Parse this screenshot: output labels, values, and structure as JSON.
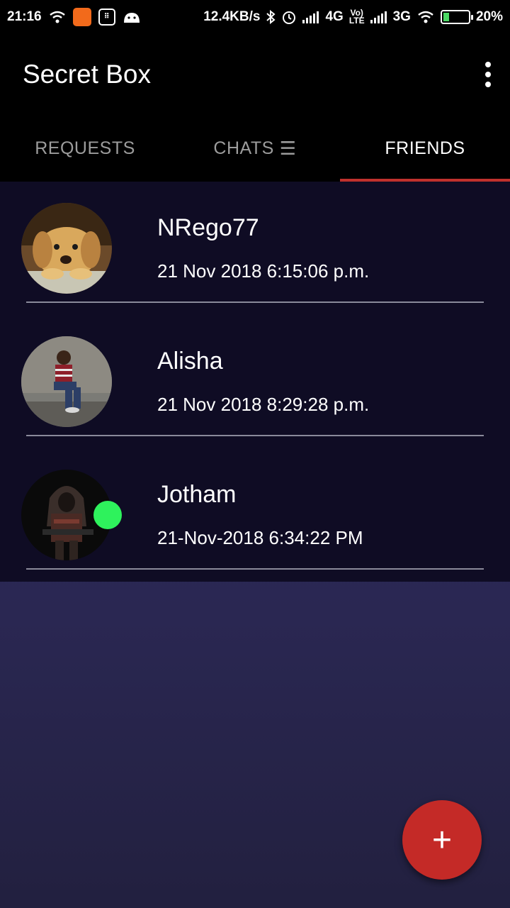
{
  "status_bar": {
    "time": "21:16",
    "network_speed": "12.4KB/s",
    "signal1_label": "4G",
    "volte_top": "Vo)",
    "volte_bottom": "LTE",
    "signal2_label": "3G",
    "battery": "20%",
    "icons": [
      "wifi-icon",
      "app-icon",
      "calculator-icon",
      "android-icon",
      "bluetooth-icon",
      "alarm-icon",
      "signal-icon",
      "wifi-icon",
      "battery-icon"
    ]
  },
  "app_bar": {
    "title": "Secret Box",
    "overflow_icon": "more-vert-icon"
  },
  "tabs": [
    {
      "label": "REQUESTS",
      "active": false
    },
    {
      "label": "CHATS",
      "glyph": "☰",
      "active": false
    },
    {
      "label": "FRIENDS",
      "active": true
    }
  ],
  "friends": [
    {
      "name": "NRego77",
      "time": "21 Nov 2018 6:15:06 p.m.",
      "avatar": "puppy-photo",
      "online": false
    },
    {
      "name": "Alisha",
      "time": "21 Nov 2018 8:29:28 p.m.",
      "avatar": "woman-photo",
      "online": false
    },
    {
      "name": "Jotham",
      "time": "21-Nov-2018 6:34:22 PM",
      "avatar": "hooded-warrior-photo",
      "online": true
    }
  ],
  "fab": {
    "label": "+",
    "icon": "add-icon"
  },
  "colors": {
    "accent": "#c0312d",
    "fab": "#c42a27",
    "online": "#2ef25c",
    "list_bg": "#0f0c24",
    "content_bg": "#302b62"
  }
}
